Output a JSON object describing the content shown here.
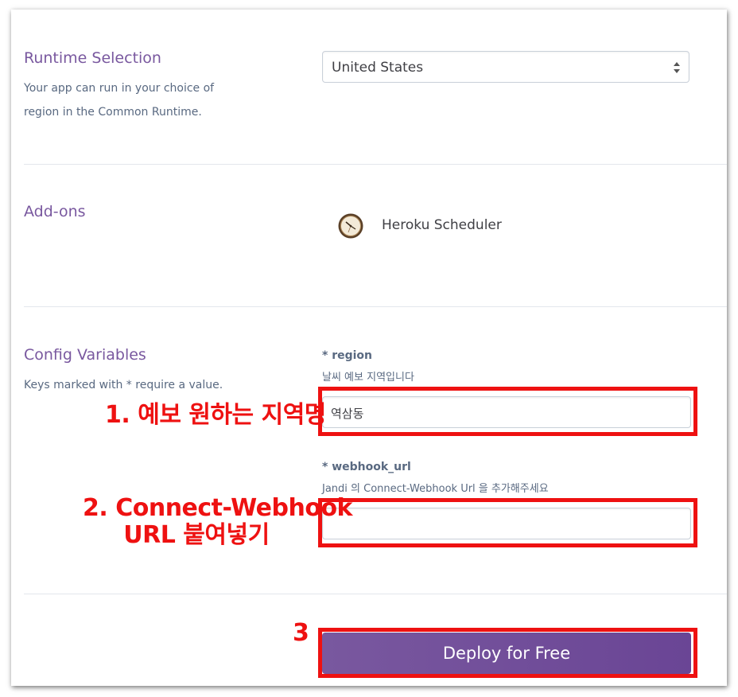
{
  "runtime": {
    "title": "Runtime Selection",
    "desc_line1": "Your app can run in your choice of",
    "desc_line2": "region in the Common Runtime.",
    "selected": "United States"
  },
  "addons": {
    "title": "Add-ons",
    "items": [
      {
        "name": "Heroku Scheduler",
        "icon": "clock-icon"
      }
    ]
  },
  "config": {
    "title": "Config Variables",
    "desc": "Keys marked with * require a value.",
    "fields": [
      {
        "key": "* region",
        "desc": "날씨 예보 지역입니다",
        "value": "역삼동"
      },
      {
        "key": "* webhook_url",
        "desc": "Jandi 의 Connect-Webhook Url 을 추가해주세요",
        "value": ""
      }
    ]
  },
  "deploy": {
    "label": "Deploy for Free"
  },
  "annotations": {
    "step1": "1. 예보 원하는 지역명",
    "step2_line1": "2. Connect-Webhook",
    "step2_line2": "URL 붙여넣기",
    "step3": "3"
  },
  "colors": {
    "accent": "#79589f",
    "annotation": "#ee1111",
    "text": "#596981"
  }
}
